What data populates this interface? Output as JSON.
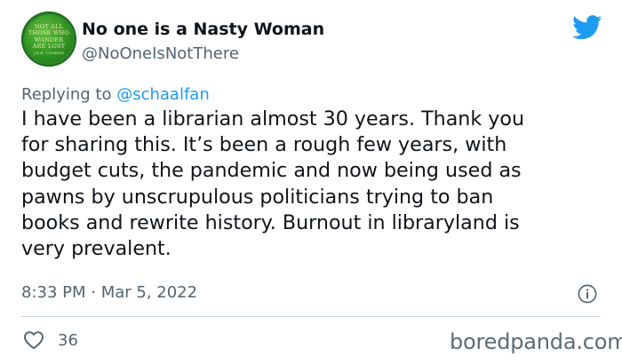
{
  "author": {
    "display_name": "No one is a Nasty Woman",
    "handle": "@NoOneIsNotThere",
    "avatar_text": [
      "NOT ALL",
      "THOSE WHO",
      "WANDER",
      "ARE LOST",
      "J.R.R. TOLKIEN"
    ]
  },
  "reply": {
    "prefix": "Replying to",
    "mention": "@schaalfan"
  },
  "tweet": {
    "lines": [
      "I have been a librarian almost 30 years. Thank you",
      "for sharing this. It’s been a rough few years, with",
      "budget cuts, the pandemic and now being used as",
      "pawns by unscrupulous politicians trying to ban",
      "books and rewrite history. Burnout in libraryland is",
      "very prevalent."
    ],
    "timestamp": "8:33 PM · Mar 5, 2022"
  },
  "stats": {
    "likes": "36"
  },
  "watermark": "boredpanda.com",
  "colors": {
    "twitter_blue": "#1d9bf0",
    "secondary_text": "#536471",
    "avatar_green": "#2f8a2a"
  },
  "icons": {
    "logo": "twitter-bird-icon",
    "info": "info-icon",
    "like": "heart-icon"
  }
}
